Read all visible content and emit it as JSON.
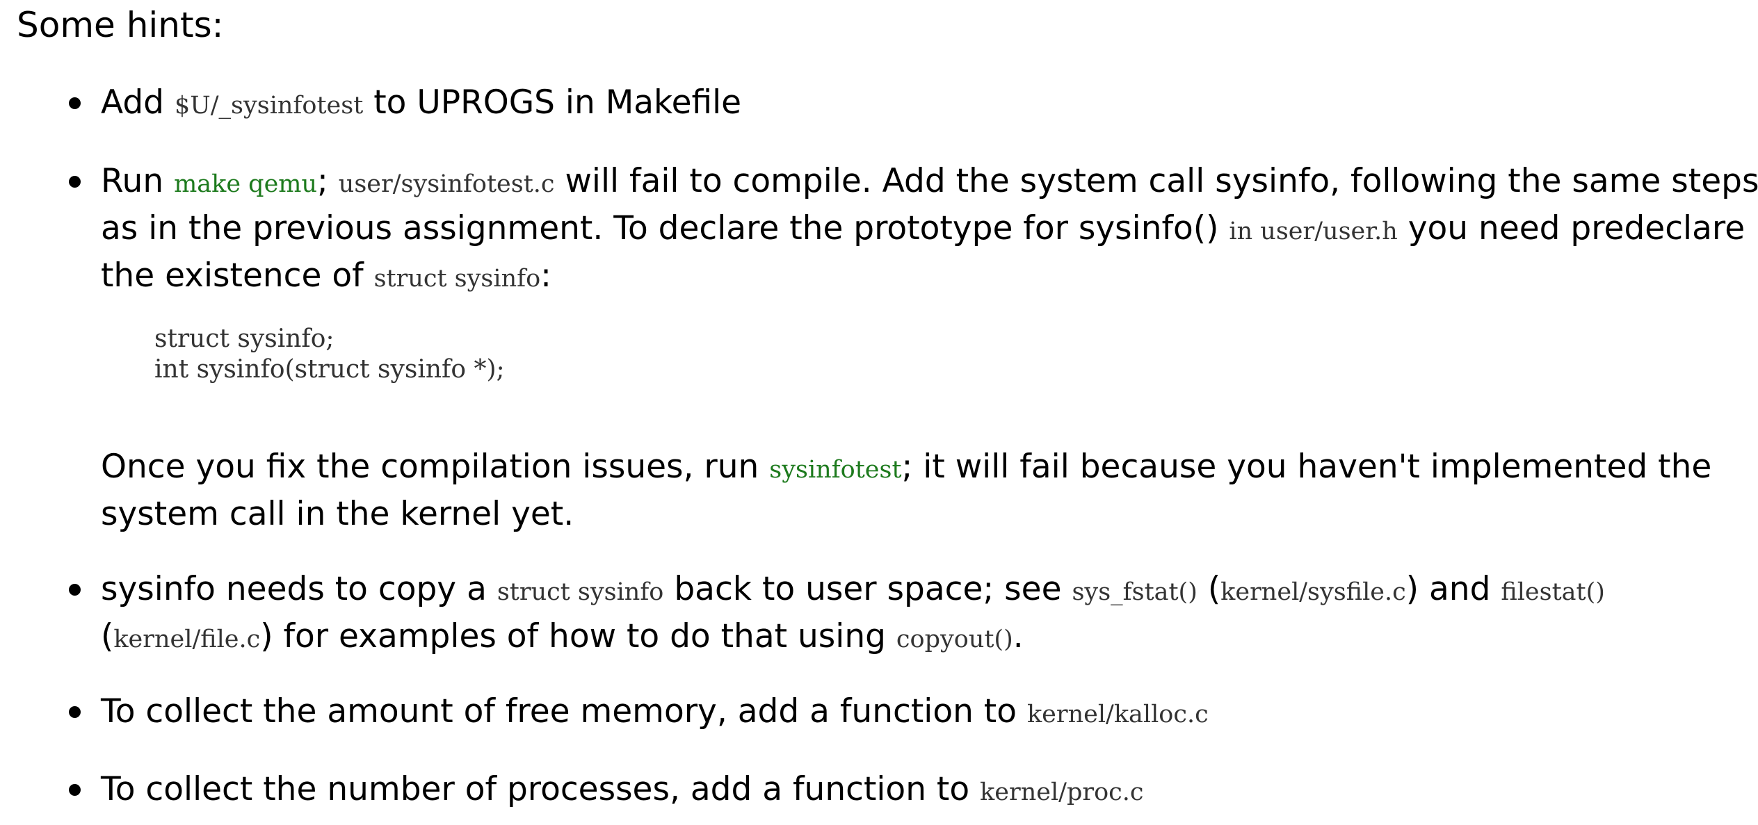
{
  "heading": "Some hints:",
  "hint1": {
    "a": "Add ",
    "code1": "$U/_sysinfotest",
    "b": " to UPROGS in Makefile"
  },
  "hint2": {
    "a": "Run ",
    "cmd1": "make qemu",
    "b": "; ",
    "code1": "user/sysinfotest.c",
    "c": " will fail to compile. Add the system call sysinfo, following the same steps",
    "d": "as in the previous assignment. To declare the prototype for sysinfo() ",
    "code2": "in user/user.h",
    "e": " you need predeclare",
    "f": "the existence of ",
    "code3": "struct sysinfo",
    "g": ":",
    "codeblock_line1": "struct sysinfo;",
    "codeblock_line2": "int sysinfo(struct sysinfo *);",
    "h": "Once you fix the compilation issues, run ",
    "cmd2": "sysinfotest",
    "i": "; it will fail because you haven't implemented the",
    "j": "system call in the kernel yet."
  },
  "hint3": {
    "a": "sysinfo needs to copy a ",
    "code1": "struct sysinfo",
    "b": " back to user space; see ",
    "code2": "sys_fstat()",
    "c": " (",
    "code3": "kernel/sysfile.c",
    "d": ") and ",
    "code4": "filestat()",
    "e": "(",
    "code5": "kernel/file.c",
    "f": ") for examples of how to do that using ",
    "code6": "copyout()",
    "g": "."
  },
  "hint4": {
    "a": "To collect the amount of free memory, add a function to ",
    "code1": "kernel/kalloc.c"
  },
  "hint5": {
    "a": "To collect the number of processes, add a function to ",
    "code1": "kernel/proc.c"
  }
}
